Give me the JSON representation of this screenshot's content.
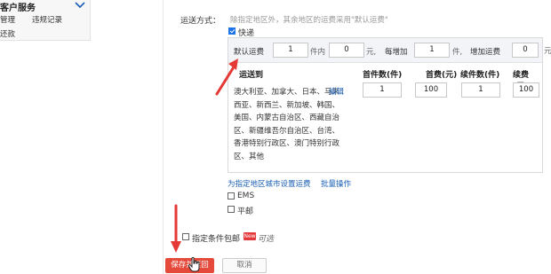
{
  "sidebar": {
    "title": "客户服务",
    "items": [
      "管理",
      "违规记录",
      "还款"
    ]
  },
  "shipping": {
    "label": "运送方式：",
    "hint": "除指定地区外，其余地区的运费采用\"默认运费\"",
    "express_label": "快递",
    "default_row": {
      "label": "默认运费",
      "first_qty": "1",
      "unit_within": "件内",
      "first_fee": "0",
      "unit_yuan": "元,",
      "each_add_label": "每增加",
      "add_qty": "1",
      "unit_piece": "件,",
      "add_fee_label": "增加运费",
      "add_fee": "0",
      "unit_yuan2": "元"
    },
    "table": {
      "headers": [
        "运送到",
        "首件数(件)",
        "首费(元)",
        "续件数(件)",
        "续费(元)"
      ],
      "region_text": "澳大利亚、加拿大、日本、马来西亚、新西兰、新加坡、韩国、美国、内蒙古自治区、西藏自治区、新疆维吾尔自治区、台湾、香港特别行政区、澳门特别行政区、其他",
      "edit_label": "编辑",
      "first_qty": "1",
      "first_fee": "100",
      "add_qty": "1",
      "add_fee": "100"
    },
    "set_city_fee_link": "为指定地区城市设置运费",
    "batch_link": "批量操作",
    "ems_label": "EMS",
    "mail_label": "平邮"
  },
  "conditional_free": {
    "label": "指定条件包邮",
    "badge": "New",
    "optional": "可选"
  },
  "buttons": {
    "save": "保存并返回",
    "cancel": "取消"
  },
  "colors": {
    "accent_red": "#e4493a",
    "link_blue": "#1a5fb4",
    "arrow_red": "#e53935"
  }
}
